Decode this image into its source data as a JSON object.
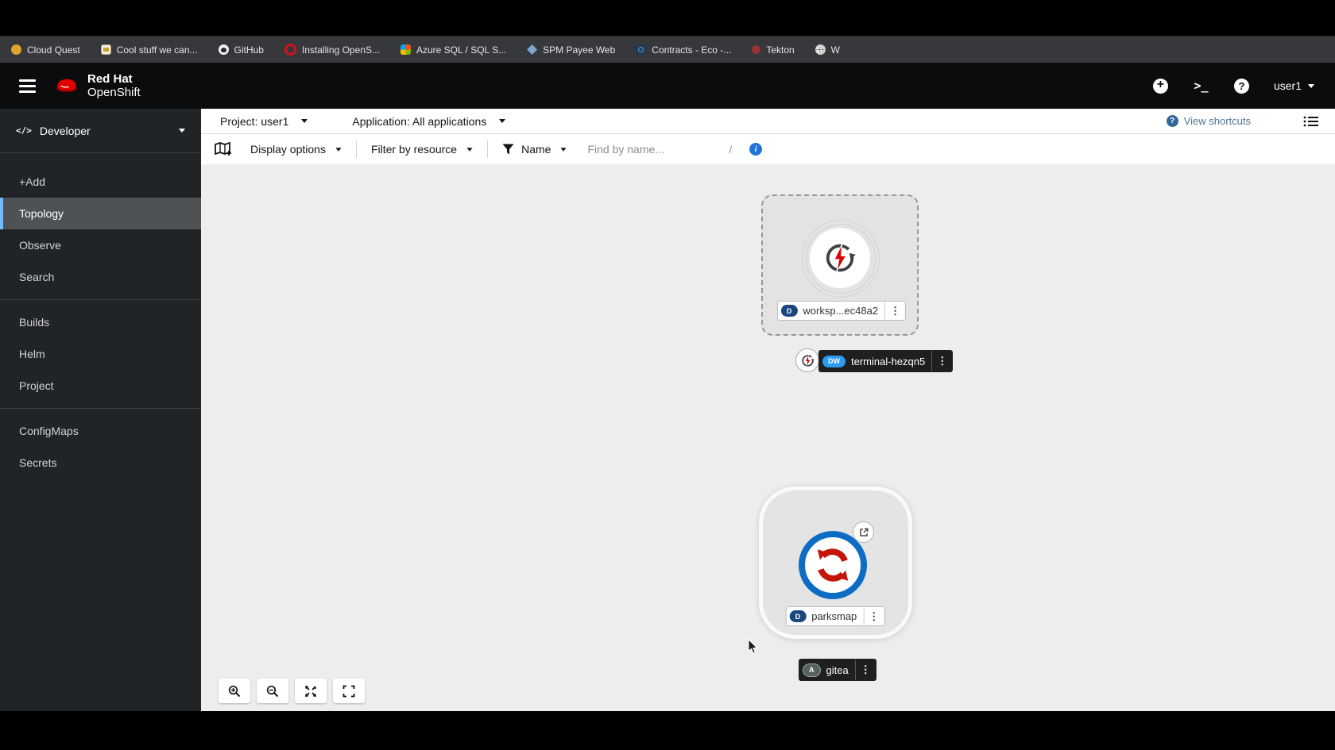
{
  "bookmarks": {
    "items": [
      {
        "label": "Cloud Quest",
        "icon": "cloud-quest-favicon"
      },
      {
        "label": "Cool stuff we can...",
        "icon": "cool-stuff-favicon"
      },
      {
        "label": "GitHub",
        "icon": "github-favicon"
      },
      {
        "label": "Installing OpenS...",
        "icon": "openshift-favicon"
      },
      {
        "label": "Azure SQL / SQL S...",
        "icon": "microsoft-favicon"
      },
      {
        "label": "SPM Payee Web",
        "icon": "spm-favicon"
      },
      {
        "label": "Contracts - Eco -...",
        "icon": "contracts-favicon"
      },
      {
        "label": "Tekton",
        "icon": "tekton-favicon"
      },
      {
        "label": "W",
        "icon": "globe-favicon"
      }
    ]
  },
  "masthead": {
    "brand_top": "Red Hat",
    "brand_bottom": "OpenShift",
    "username": "user1"
  },
  "sidebar": {
    "perspective": "Developer",
    "items": [
      {
        "label": "+Add"
      },
      {
        "label": "Topology",
        "active": true
      },
      {
        "label": "Observe"
      },
      {
        "label": "Search"
      },
      {
        "label": "Builds"
      },
      {
        "label": "Helm"
      },
      {
        "label": "Project"
      },
      {
        "label": "ConfigMaps"
      },
      {
        "label": "Secrets"
      }
    ]
  },
  "context_bar": {
    "project": "Project: user1",
    "application": "Application: All applications",
    "view_shortcuts": "View shortcuts"
  },
  "filter_bar": {
    "display_options": "Display options",
    "filter_by_resource": "Filter by resource",
    "name_filter": "Name",
    "search_placeholder": "Find by name...",
    "shortcut_hint": "/"
  },
  "topology": {
    "workspace": {
      "badge": "D",
      "label": "worksp...ec48a2"
    },
    "terminal": {
      "badge": "DW",
      "label": "terminal-hezqn5"
    },
    "parksmap": {
      "badge": "D",
      "label": "parksmap"
    },
    "gitea": {
      "badge": "A",
      "label": "gitea"
    }
  },
  "colors": {
    "brand_red": "#ee0000",
    "accent_blue": "#2b9af3",
    "nav_active_border": "#73bcf7",
    "badge_navy": "#19477f",
    "parksmap_ring": "#0d6dc4",
    "icon_red": "#e00000"
  }
}
